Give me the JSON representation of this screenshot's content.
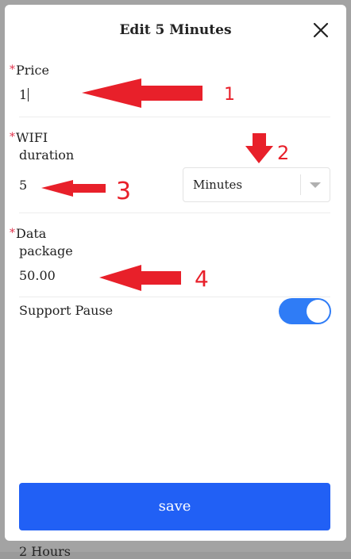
{
  "background_item": "2 Hours",
  "modal": {
    "title": "Edit 5 Minutes",
    "close_icon": "close-icon"
  },
  "fields": {
    "price": {
      "required_mark": "*",
      "label": "Price",
      "value": "1"
    },
    "wifi_duration": {
      "required_mark": "*",
      "label_line1": "WIFI",
      "label_line2": "duration",
      "value": "5",
      "unit_selected": "Minutes"
    },
    "data_package": {
      "required_mark": "*",
      "label_line1": "Data",
      "label_line2": "package",
      "value": "50.00"
    },
    "support_pause": {
      "label": "Support Pause",
      "enabled": true
    }
  },
  "actions": {
    "save_label": "save"
  },
  "annotations": {
    "color": "#e8202a",
    "numbers": [
      "1",
      "2",
      "3",
      "4"
    ]
  },
  "colors": {
    "primary": "#2160f5",
    "toggle_on": "#2f7cf6",
    "required": "#e0334c"
  }
}
